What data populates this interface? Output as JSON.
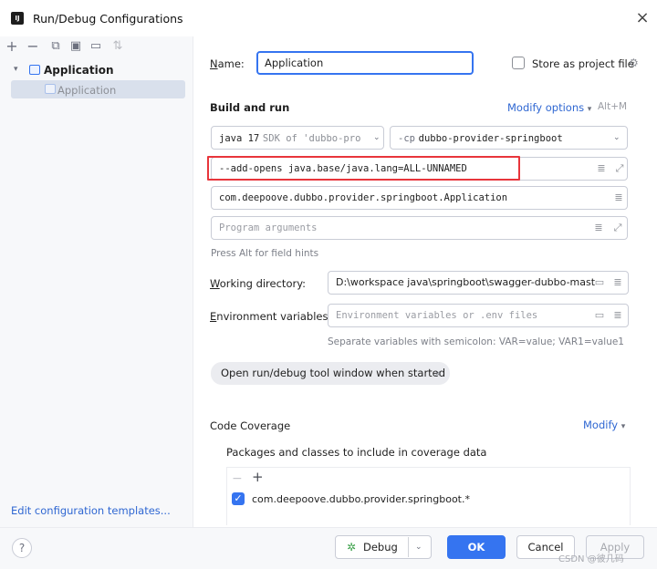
{
  "window": {
    "title": "Run/Debug Configurations",
    "icon_text": "IJ"
  },
  "left_panel": {
    "tree_root": "Application",
    "tree_child": "Application",
    "edit_templates_link": "Edit configuration templates..."
  },
  "form": {
    "name_label": "Name:",
    "name_value": "Application",
    "store_label": "Store as project file",
    "build_run_heading": "Build and run",
    "modify_options": "Modify options",
    "modify_shortcut": "Alt+M",
    "sdk_value": "java 17",
    "sdk_detail": "SDK of 'dubbo-pro",
    "classpath_prefix": "-cp",
    "classpath_value": "dubbo-provider-springboot",
    "vm_options": "--add-opens java.base/java.lang=ALL-UNNAMED",
    "main_class": "com.deepoove.dubbo.provider.springboot.Application",
    "program_args_placeholder": "Program arguments",
    "field_hint": "Press Alt for field hints",
    "workdir_label": "Working directory:",
    "workdir_value": "D:\\workspace java\\springboot\\swagger-dubbo-mast",
    "env_label": "Environment variables:",
    "env_placeholder": "Environment variables or .env files",
    "env_hint": "Separate variables with semicolon: VAR=value; VAR1=value1",
    "tool_window_chip": "Open run/debug tool window when started",
    "code_coverage_heading": "Code Coverage",
    "coverage_modify": "Modify",
    "packages_label": "Packages and classes to include in coverage data",
    "coverage_entry": "com.deepoove.dubbo.provider.springboot.*"
  },
  "buttons": {
    "debug": "Debug",
    "ok": "OK",
    "cancel": "Cancel",
    "apply": "Apply"
  },
  "watermark": "CSDN @彼几码",
  "colors": {
    "accent": "#3574f0",
    "highlight_box": "#e8353b",
    "link": "#2f67d2"
  }
}
